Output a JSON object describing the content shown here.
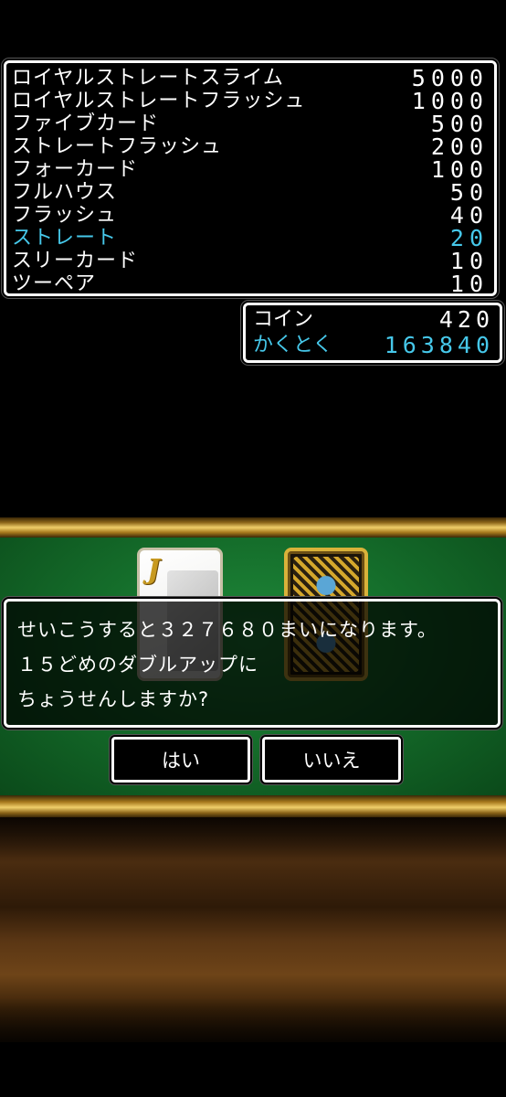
{
  "paytable": {
    "rows": [
      {
        "hand": "ロイヤルストレートスライム",
        "multiplier": "5000",
        "highlighted": false
      },
      {
        "hand": "ロイヤルストレートフラッシュ",
        "multiplier": "1000",
        "highlighted": false
      },
      {
        "hand": "ファイブカード",
        "multiplier": "500",
        "highlighted": false
      },
      {
        "hand": "ストレートフラッシュ",
        "multiplier": "200",
        "highlighted": false
      },
      {
        "hand": "フォーカード",
        "multiplier": "100",
        "highlighted": false
      },
      {
        "hand": "フルハウス",
        "multiplier": "50",
        "highlighted": false
      },
      {
        "hand": "フラッシュ",
        "multiplier": "40",
        "highlighted": false
      },
      {
        "hand": "ストレート",
        "multiplier": "20",
        "highlighted": true
      },
      {
        "hand": "スリーカード",
        "multiplier": "10",
        "highlighted": false
      },
      {
        "hand": "ツーペア",
        "multiplier": "10",
        "highlighted": false
      }
    ]
  },
  "coins": {
    "coin_label": "コイン",
    "coin_value": "420",
    "acquired_label": "かくとく",
    "acquired_value": "163840"
  },
  "cards": {
    "face_up_rank": "J"
  },
  "message": {
    "lines": [
      "せいこうすると３２７６８０まいになります。",
      "１５どめのダブルアップに",
      "ちょうせんしますか?"
    ]
  },
  "buttons": {
    "yes_label": "はい",
    "no_label": "いいえ"
  },
  "colors": {
    "highlight": "#46c8ea",
    "text": "#ffffff",
    "felt": "#156e2b",
    "gold": "#f0cf6a"
  }
}
